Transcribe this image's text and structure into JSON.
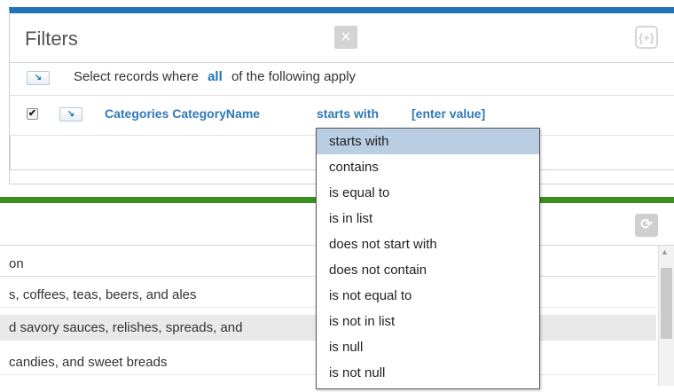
{
  "filters": {
    "title": "Filters",
    "clear_icon": "×",
    "expand_icon": "{+}",
    "arrow_icon": "↘",
    "header_row": {
      "prefix": "Select records where",
      "quantifier": "all",
      "suffix": "of the following apply"
    },
    "condition": {
      "checked": true,
      "check_glyph": "✔",
      "field": "Categories CategoryName",
      "operator": "starts with",
      "value": "[enter value]"
    }
  },
  "grid": {
    "refresh_icon": "⟳",
    "header_fragment": "on",
    "rows": [
      "s, coffees, teas, beers, and ales",
      "d savory sauces, relishes, spreads, and",
      "candies, and sweet breads"
    ],
    "scroll_up_glyph": "▲"
  },
  "operator_dropdown": {
    "selected": "starts with",
    "options": [
      "starts with",
      "contains",
      "is equal to",
      "is in list",
      "does not start with",
      "does not contain",
      "is not equal to",
      "is not in list",
      "is null",
      "is not null"
    ]
  },
  "colors": {
    "filters_accent": "#1f73b7",
    "grid_accent": "#3a8f1f",
    "link_blue": "#1f73b7",
    "selected_option_bg": "#b9cde3"
  }
}
